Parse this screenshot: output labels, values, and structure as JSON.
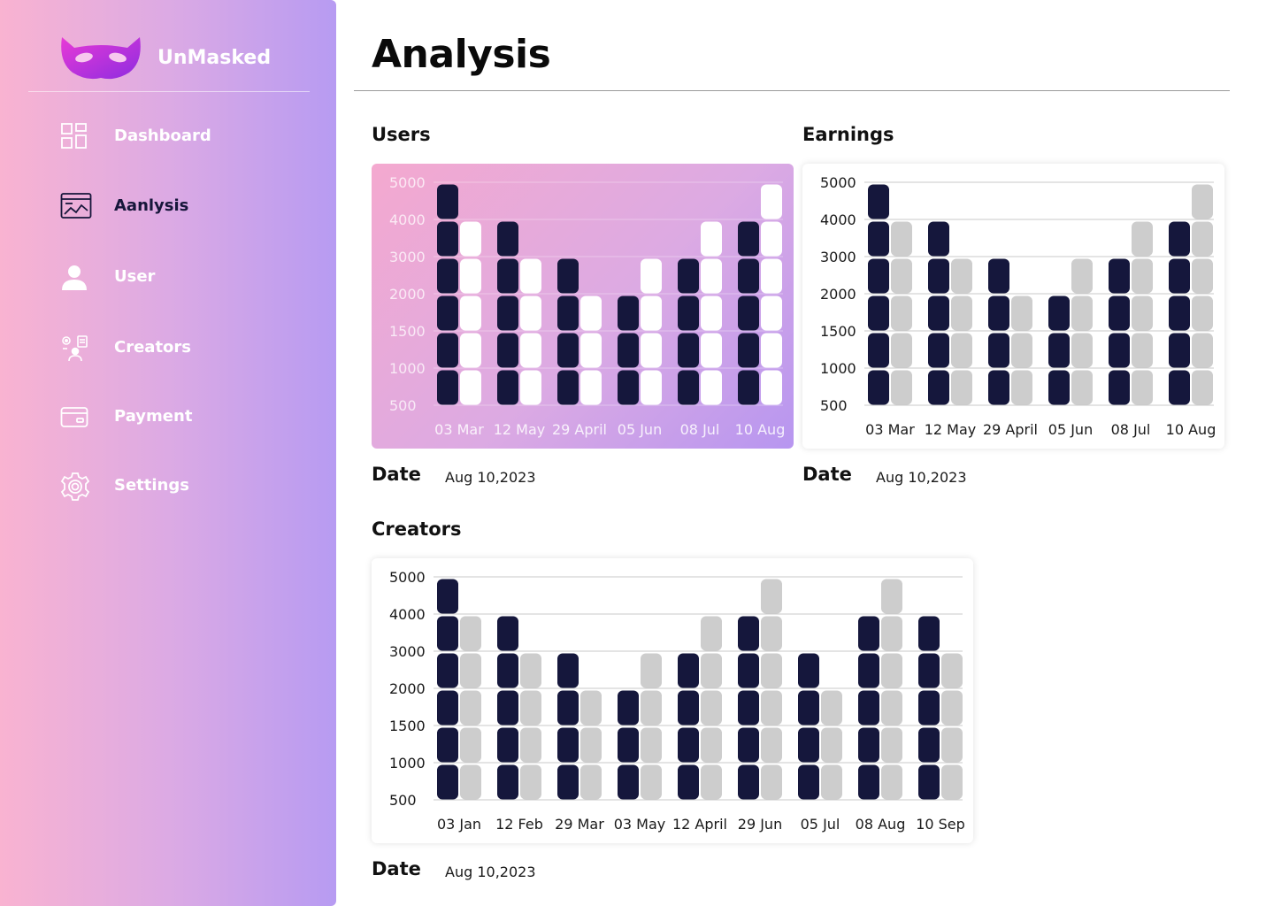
{
  "brand": {
    "name": "UnMasked",
    "logo_icon": "mask-icon"
  },
  "nav": [
    {
      "label": "Dashboard",
      "icon": "dashboard-icon",
      "active": false
    },
    {
      "label": "Aanlysis",
      "icon": "analysis-icon",
      "active": true
    },
    {
      "label": "User",
      "icon": "user-icon",
      "active": false
    },
    {
      "label": "Creators",
      "icon": "creators-icon",
      "active": false
    },
    {
      "label": "Payment",
      "icon": "card-icon",
      "active": false
    },
    {
      "label": "Settings",
      "icon": "gear-icon",
      "active": false
    }
  ],
  "page": {
    "title": "Analysis"
  },
  "colors": {
    "dark_bar": "#15173c",
    "light_bar": "#cdcdcd",
    "white_bar": "#ffffff"
  },
  "users": {
    "title": "Users",
    "date_label": "Date",
    "date_value": "Aug 10,2023"
  },
  "earnings": {
    "title": "Earnings",
    "date_label": "Date",
    "date_value": "Aug 10,2023"
  },
  "creators": {
    "title": "Creators",
    "date_label": "Date",
    "date_value": "Aug 10,2023"
  },
  "chart_data": [
    {
      "type": "bar",
      "title": "Users",
      "categories": [
        "03 Mar",
        "12 May",
        "29 April",
        "05 Jun",
        "08 Jul",
        "10 Aug"
      ],
      "y_tick_labels": [
        "5000",
        "4000",
        "3000",
        "2000",
        "1500",
        "1000",
        "500"
      ],
      "series": [
        {
          "values": [
            5000,
            4000,
            3000,
            2000,
            3000,
            4000
          ]
        },
        {
          "values": [
            4000,
            3000,
            2000,
            3000,
            4000,
            5000
          ]
        }
      ],
      "grid": true
    },
    {
      "type": "bar",
      "title": "Earnings",
      "categories": [
        "03 Mar",
        "12 May",
        "29 April",
        "05 Jun",
        "08 Jul",
        "10 Aug"
      ],
      "y_tick_labels": [
        "5000",
        "4000",
        "3000",
        "2000",
        "1500",
        "1000",
        "500"
      ],
      "series": [
        {
          "values": [
            5000,
            4000,
            3000,
            2000,
            3000,
            4000
          ]
        },
        {
          "values": [
            4000,
            3000,
            2000,
            3000,
            4000,
            5000
          ]
        }
      ],
      "grid": true
    },
    {
      "type": "bar",
      "title": "Creators",
      "categories": [
        "03 Jan",
        "12 Feb",
        "29 Mar",
        "03 May",
        "12 April",
        "29 Jun",
        "05 Jul",
        "08 Aug",
        "10 Sep"
      ],
      "y_tick_labels": [
        "5000",
        "4000",
        "3000",
        "2000",
        "1500",
        "1000",
        "500"
      ],
      "series": [
        {
          "values": [
            5000,
            4000,
            3000,
            2000,
            3000,
            4000,
            3000,
            4000,
            4000
          ]
        },
        {
          "values": [
            4000,
            3000,
            2000,
            3000,
            4000,
            5000,
            2000,
            5000,
            3000
          ]
        }
      ],
      "grid": true
    }
  ]
}
